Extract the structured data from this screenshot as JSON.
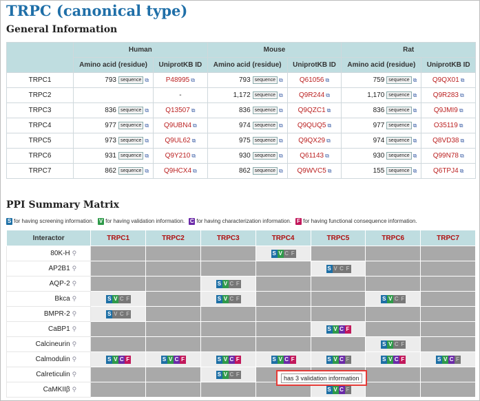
{
  "title": "TRPC (canonical type)",
  "general": {
    "heading": "General Information",
    "species": [
      "Human",
      "Mouse",
      "Rat"
    ],
    "subcols": {
      "aa": "Amino acid (residue)",
      "uni": "UniprotKB ID"
    },
    "seq_label": "sequence",
    "rows": [
      {
        "name": "TRPC1",
        "h_aa": "793",
        "h_id": "P48995",
        "m_aa": "793",
        "m_id": "Q61056",
        "r_aa": "759",
        "r_id": "Q9QX01"
      },
      {
        "name": "TRPC2",
        "h_aa": "",
        "h_id": "-",
        "m_aa": "1,172",
        "m_id": "Q9R244",
        "r_aa": "1,170",
        "r_id": "Q9R283"
      },
      {
        "name": "TRPC3",
        "h_aa": "836",
        "h_id": "Q13507",
        "m_aa": "836",
        "m_id": "Q9QZC1",
        "r_aa": "836",
        "r_id": "Q9JMI9"
      },
      {
        "name": "TRPC4",
        "h_aa": "977",
        "h_id": "Q9UBN4",
        "m_aa": "974",
        "m_id": "Q9QUQ5",
        "r_aa": "977",
        "r_id": "O35119"
      },
      {
        "name": "TRPC5",
        "h_aa": "973",
        "h_id": "Q9UL62",
        "m_aa": "975",
        "m_id": "Q9QX29",
        "r_aa": "974",
        "r_id": "Q8VD38"
      },
      {
        "name": "TRPC6",
        "h_aa": "931",
        "h_id": "Q9Y210",
        "m_aa": "930",
        "m_id": "Q61143",
        "r_aa": "930",
        "r_id": "Q99N78"
      },
      {
        "name": "TRPC7",
        "h_aa": "862",
        "h_id": "Q9HCX4",
        "m_aa": "862",
        "m_id": "Q9WVC5",
        "r_aa": "155",
        "r_id": "Q6TPJ4"
      }
    ]
  },
  "ppi": {
    "heading": "PPI Summary Matrix",
    "legend": [
      {
        "letter": "S",
        "text": "for having screening information."
      },
      {
        "letter": "V",
        "text": "for having validation information."
      },
      {
        "letter": "C",
        "text": "for having characterization information."
      },
      {
        "letter": "F",
        "text": "for having functional consequence information."
      }
    ],
    "interactor_header": "Interactor",
    "columns": [
      "TRPC1",
      "TRPC2",
      "TRPC3",
      "TRPC4",
      "TRPC5",
      "TRPC6",
      "TRPC7"
    ],
    "rows": [
      {
        "name": "80K-H",
        "cells": [
          "",
          "",
          "",
          "SV",
          "",
          "",
          ""
        ]
      },
      {
        "name": "AP2B1",
        "cells": [
          "",
          "",
          "",
          "",
          "S",
          "",
          ""
        ]
      },
      {
        "name": "AQP-2",
        "cells": [
          "",
          "",
          "SV",
          "",
          "",
          "",
          ""
        ]
      },
      {
        "name": "Bkca",
        "cells": [
          "SV",
          "",
          "SV",
          "",
          "",
          "SV",
          ""
        ]
      },
      {
        "name": "BMPR-2",
        "cells": [
          "S",
          "",
          "",
          "",
          "",
          "",
          ""
        ]
      },
      {
        "name": "CaBP1",
        "cells": [
          "",
          "",
          "",
          "",
          "SVCF",
          "",
          ""
        ]
      },
      {
        "name": "Calcineurin",
        "cells": [
          "",
          "",
          "",
          "",
          "",
          "SV",
          ""
        ]
      },
      {
        "name": "Calmodulin",
        "cells": [
          "SVCF",
          "SVCF",
          "SVCF",
          "SVCF",
          "SVC",
          "SVCF",
          "SVC"
        ]
      },
      {
        "name": "Calreticulin",
        "cells": [
          "",
          "",
          "SV",
          "",
          "",
          "",
          ""
        ]
      },
      {
        "name": "CaMKIIβ",
        "cells": [
          "",
          "",
          "",
          "",
          "SVC",
          "",
          ""
        ]
      }
    ],
    "tooltip": "has 3 validation information"
  }
}
